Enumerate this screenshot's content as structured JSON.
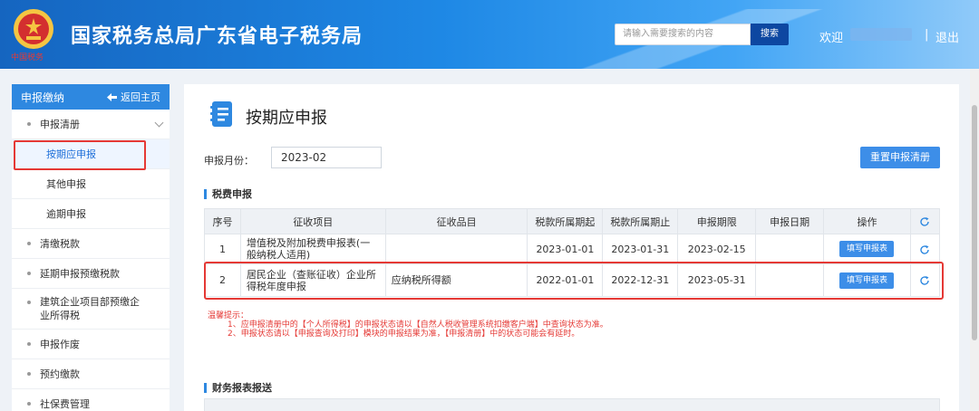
{
  "header": {
    "site_title": "国家税务总局广东省电子税务局",
    "emblem_text": "中国税务",
    "search_placeholder": "请输入需要搜索的内容",
    "search_button": "搜索",
    "welcome": "欢迎",
    "separator": "|",
    "logout": "退出"
  },
  "sidebar": {
    "head_label": "申报缴纳",
    "back_label": "返回主页",
    "items": [
      {
        "label": "申报清册"
      },
      {
        "label": "按期应申报"
      },
      {
        "label": "其他申报"
      },
      {
        "label": "逾期申报"
      },
      {
        "label": "清缴税款"
      },
      {
        "label": "延期申报预缴税款"
      },
      {
        "label": "建筑企业项目部预缴企业所得税"
      },
      {
        "label": "申报作废"
      },
      {
        "label": "预约缴款"
      },
      {
        "label": "社保费管理"
      }
    ]
  },
  "main": {
    "page_title": "按期应申报",
    "month_label": "申报月份：",
    "month_value": "2023-02",
    "reset_button": "重置申报清册",
    "section1_title": "税费申报",
    "section2_title": "财务报表报送",
    "table": {
      "headers": [
        "序号",
        "征收项目",
        "征收品目",
        "税款所属期起",
        "税款所属期止",
        "申报期限",
        "申报日期",
        "操作"
      ],
      "rows": [
        {
          "no": "1",
          "item": "增值税及附加税费申报表(一般纳税人适用)",
          "category": "",
          "start": "2023-01-01",
          "end": "2023-01-31",
          "deadline": "2023-02-15",
          "date": "",
          "action": "填写申报表"
        },
        {
          "no": "2",
          "item": "居民企业（查账征收）企业所得税年度申报",
          "category": "应纳税所得额",
          "start": "2022-01-01",
          "end": "2022-12-31",
          "deadline": "2023-05-31",
          "date": "",
          "action": "填写申报表"
        }
      ]
    },
    "tips": {
      "title": "温馨提示：",
      "line1": "1、应申报清册中的【个人所得税】的申报状态请以【自然人税收管理系统扣缴客户端】中查询状态为准。",
      "line2": "2、申报状态请以【申报查询及打印】模块的申报结果为准，【申报清册】中的状态可能会有延时。"
    }
  },
  "colors": {
    "accent": "#2e88e0",
    "button": "#3d8ee8",
    "highlight": "#e53935"
  }
}
